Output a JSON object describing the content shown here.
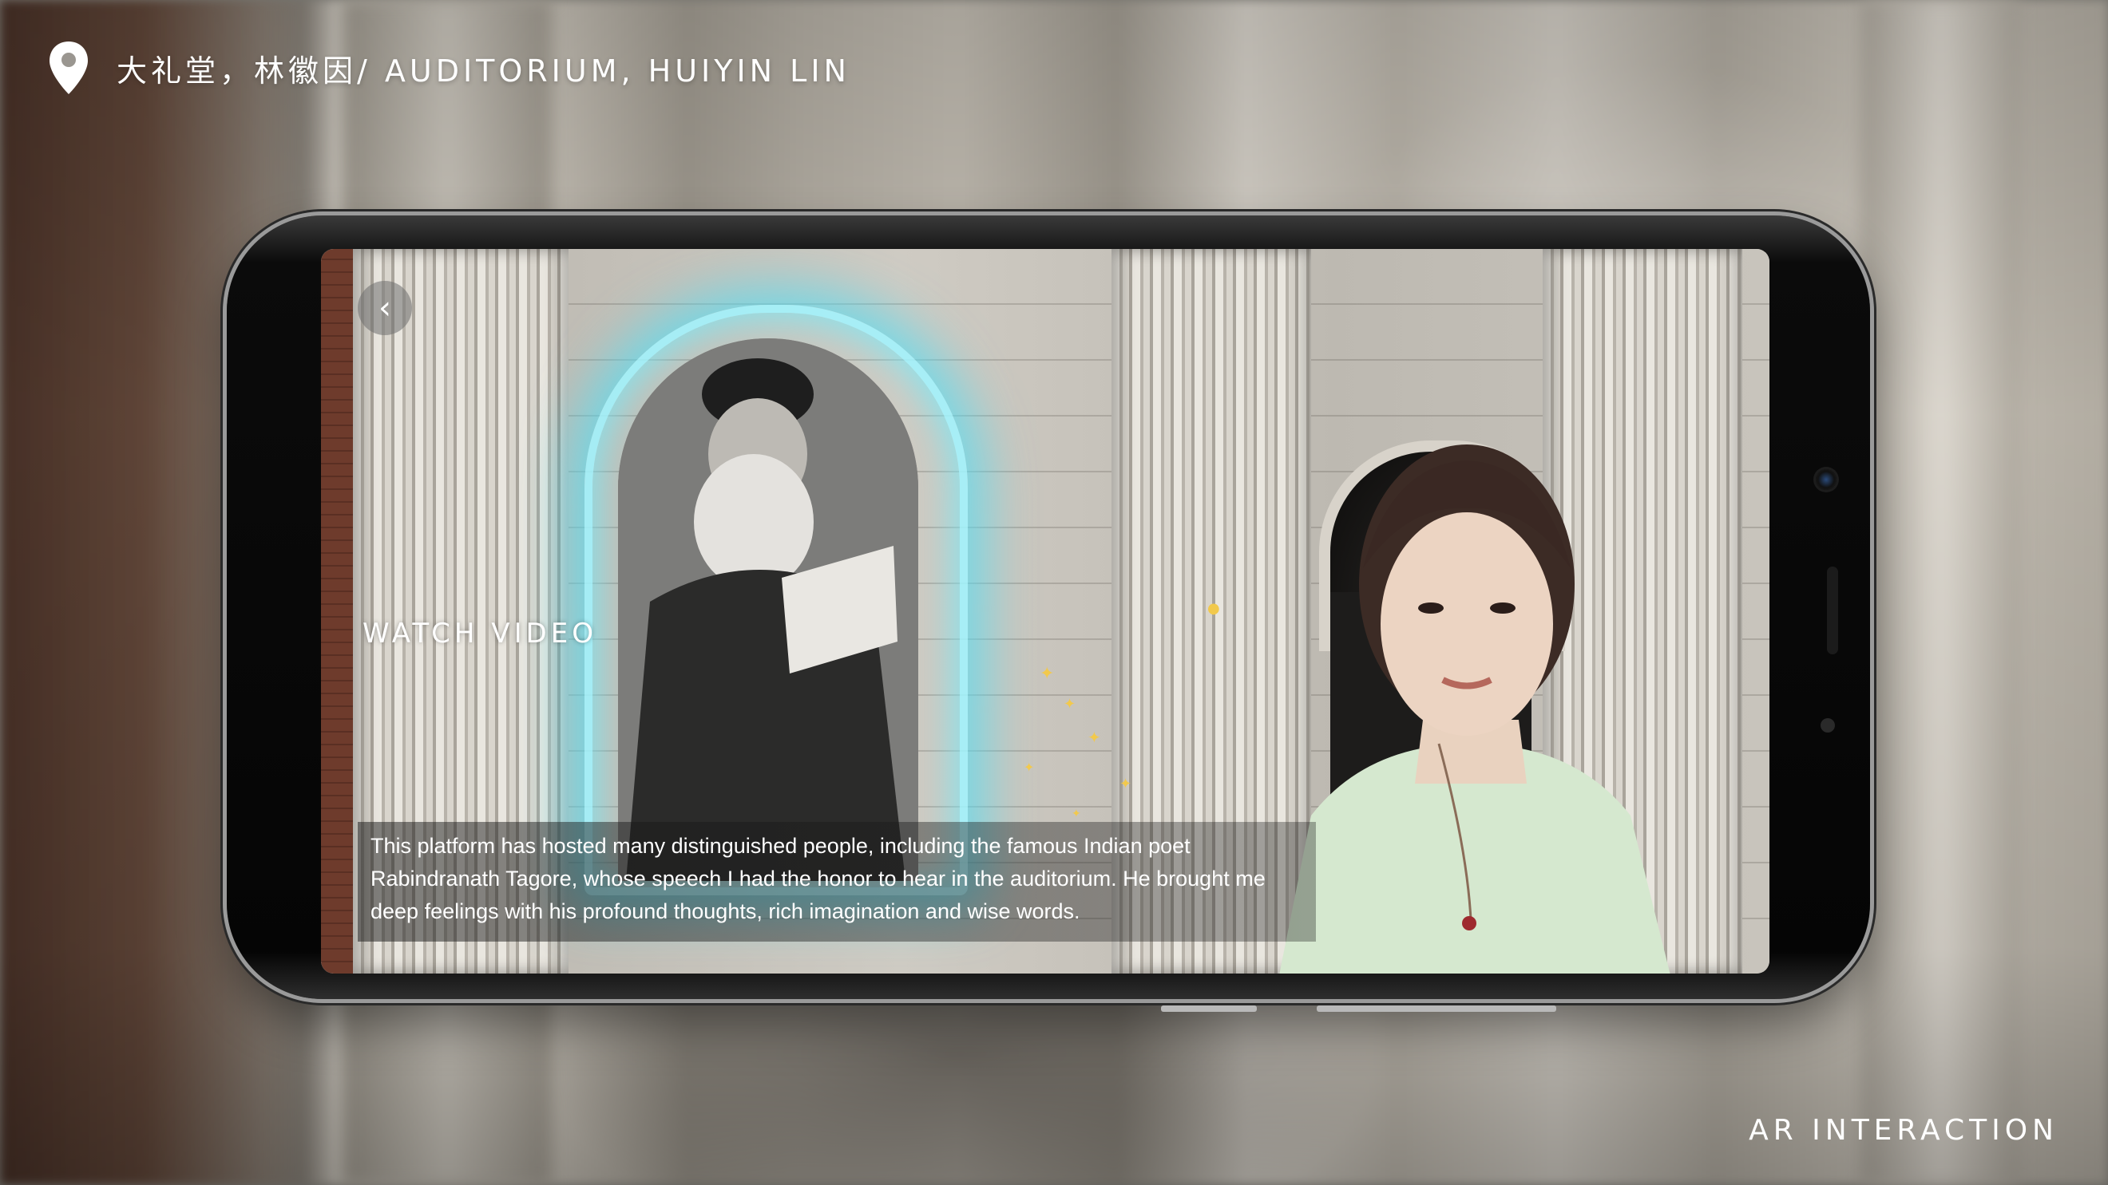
{
  "header": {
    "location_label": "大礼堂，林徽因/ AUDITORIUM, HUIYIN LIN"
  },
  "footer": {
    "caption": "AR INTERACTION"
  },
  "screen": {
    "back_symbol": "‹",
    "watch_video_label": "WATCH VIDEO",
    "subtitle": "This platform has hosted many distinguished people, including the famous Indian poet Rabindranath Tagore, whose speech I had the honor to hear in the auditorium. He brought me deep feelings with his profound thoughts, rich imagination and wise words."
  },
  "icons": {
    "location": "map-pin-icon",
    "back": "chevron-left-icon"
  },
  "colors": {
    "portal_glow": "#5adcf0",
    "sparkle": "#f2c94c",
    "text": "#ffffff"
  }
}
